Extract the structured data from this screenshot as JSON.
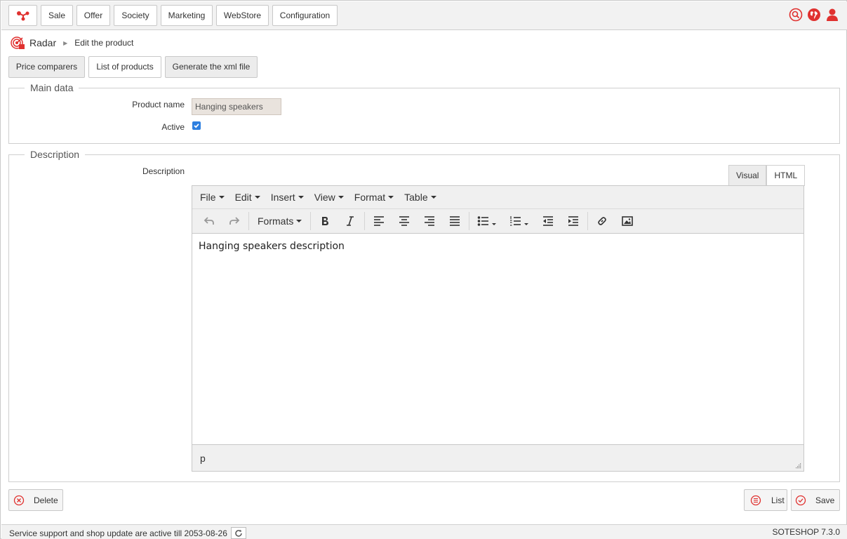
{
  "nav": {
    "items": [
      "Sale",
      "Offer",
      "Society",
      "Marketing",
      "WebStore",
      "Configuration"
    ]
  },
  "breadcrumb": {
    "root": "Radar",
    "separator": "▶",
    "page": "Edit the product"
  },
  "tabs": [
    "Price comparers",
    "List of products",
    "Generate the xml file"
  ],
  "main_data": {
    "legend": "Main data",
    "product_name_label": "Product name",
    "product_name_value": "Hanging speakers",
    "active_label": "Active",
    "active_checked": true
  },
  "description": {
    "legend": "Description",
    "label": "Description",
    "mode_tabs": [
      "Visual",
      "HTML"
    ],
    "menu": [
      "File",
      "Edit",
      "Insert",
      "View",
      "Format",
      "Table"
    ],
    "formats_label": "Formats",
    "content": "Hanging speakers description",
    "path": "p"
  },
  "actions": {
    "delete": "Delete",
    "list": "List",
    "save": "Save"
  },
  "footer": {
    "support": "Service support and shop update are active till 2053-08-26",
    "version": "SOTESHOP 7.3.0"
  },
  "colors": {
    "accent": "#e0312f",
    "checkbox": "#2d7fe0"
  }
}
